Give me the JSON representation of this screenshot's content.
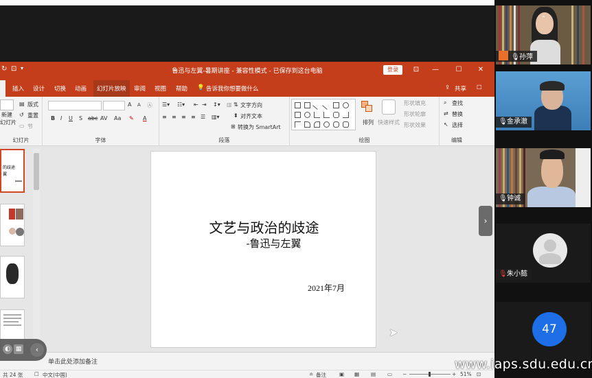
{
  "powerpoint": {
    "window_title": "鲁迅与左翼-暑期讲座 - 兼容性模式 - 已保存到这台电脑",
    "login_label": "登录",
    "tabs": [
      "插入",
      "设计",
      "切换",
      "动画",
      "幻灯片放映",
      "审阅",
      "视图",
      "帮助"
    ],
    "active_tab": "幻灯片放映",
    "tell_me": "告诉我你想要做什么",
    "share_label": "共享",
    "ribbon": {
      "slides": {
        "new_slide": "新建",
        "new_slide2": "幻灯片",
        "layout": "版式",
        "reset": "重置",
        "section": "节",
        "group": "幻灯片"
      },
      "font": {
        "group": "字体",
        "grow": "A",
        "shrink": "A",
        "bold": "B",
        "italic": "I",
        "underline": "U",
        "strike": "S",
        "shadow": "abc",
        "spacing": "AV",
        "case": "Aa",
        "color": "A"
      },
      "paragraph": {
        "group": "段落",
        "text_direction": "文字方向",
        "align_text": "对齐文本",
        "smartart": "转换为 SmartArt"
      },
      "drawing": {
        "group": "绘图",
        "arrange": "排列",
        "quick_styles": "快速样式",
        "fill": "形状填充",
        "outline": "形状轮廓",
        "effects": "形状效果"
      },
      "editing": {
        "group": "编辑",
        "find": "查找",
        "replace": "替换",
        "select": "选择"
      }
    },
    "slide": {
      "title": "文艺与政治的歧途",
      "subtitle": "-鲁迅与左翼",
      "date": "2021年7月"
    },
    "thumb1_text": "的歧途",
    "thumb1_sub": "翼",
    "notes_placeholder": "单击此处添加备注",
    "status": {
      "slide_count": "共 24 张",
      "language": "中文(中国)",
      "notes": "备注",
      "zoom": "51%",
      "minus": "−",
      "plus": "+"
    }
  },
  "meeting": {
    "participants": [
      {
        "name": "孙萍",
        "type": "video"
      },
      {
        "name": "金承澈",
        "type": "video"
      },
      {
        "name": "钟诚",
        "type": "video"
      },
      {
        "name": "朱小懿",
        "type": "avatar",
        "muted": true
      },
      {
        "name": "47",
        "type": "count"
      }
    ]
  },
  "watermark": "www.iaps.sdu.edu.cn",
  "colors": {
    "ppt_accent": "#c43e1c",
    "meeting_blue": "#1e6ee8",
    "mic_orange": "#e8702a"
  }
}
